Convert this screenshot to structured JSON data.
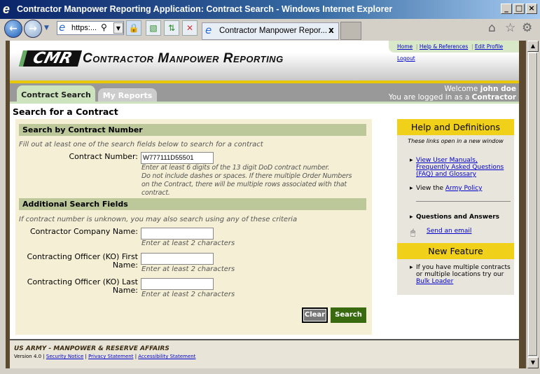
{
  "window": {
    "title": "Contractor Manpower Reporting Application: Contract Search - Windows Internet Explorer"
  },
  "browser": {
    "address": "https:...",
    "tab_title": "Contractor Manpower Repor...",
    "tab_close": "x"
  },
  "header": {
    "logo_abbr": "CMR",
    "logo_text": "Contractor Manpower Reporting",
    "links": [
      "Home",
      "Help & References",
      "Edit Profile",
      "Logout"
    ]
  },
  "tabs": [
    {
      "label": "Contract Search"
    },
    {
      "label": "My Reports"
    }
  ],
  "user": {
    "welcome": "Welcome",
    "name": "john doe",
    "logged_in": "You are logged in as a",
    "role": "Contractor"
  },
  "main": {
    "title": "Search for a Contract",
    "section1": {
      "title": "Search by Contract Number",
      "hint": "Fill out at least one of the search fields below to search for a contract",
      "label": "Contract Number:",
      "value": "W777111D55501",
      "help": [
        "Enter at least 6 digits of the 13 digit DoD contract number.",
        "Do not include dashes or spaces. If there multiple Order Numbers",
        "on the Contract, there will be multiple rows associated with that",
        "contract."
      ]
    },
    "section2": {
      "title": "Additional Search Fields",
      "hint": "If contract number is unknown, you may also search using any of these criteria",
      "fields": [
        {
          "label": "Contractor Company Name:",
          "value": "",
          "help": "Enter at least 2 characters"
        },
        {
          "label_1": "Contracting Officer (KO) First",
          "label_2": "Name:",
          "value": "",
          "help": "Enter at least 2 characters"
        },
        {
          "label_1": "Contracting Officer (KO) Last",
          "label_2": "Name:",
          "value": "",
          "help": "Enter at least 2 characters"
        }
      ]
    },
    "clear_label": "Clear",
    "search_label": "Search"
  },
  "sidebar": {
    "help_title": "Help and Definitions",
    "note": "These links open in a new window",
    "manuals_link": "View User Manuals, Frequently Asked Questions (FAQ) and Glossary",
    "policy_prefix": "View the",
    "policy_link": "Army Policy",
    "qa_title": "Questions and Answers",
    "email_link": "Send an email",
    "feature_title": "New Feature",
    "feature_text": "If you have multiple contracts or multiple locations try our",
    "feature_link": "Bulk Loader"
  },
  "footer": {
    "org": "US ARMY - MANPOWER & RESERVE AFFAIRS",
    "version": "Version 4.0",
    "links": [
      "Security Notice",
      "Privacy Statement",
      "Accessibility Statement"
    ]
  }
}
